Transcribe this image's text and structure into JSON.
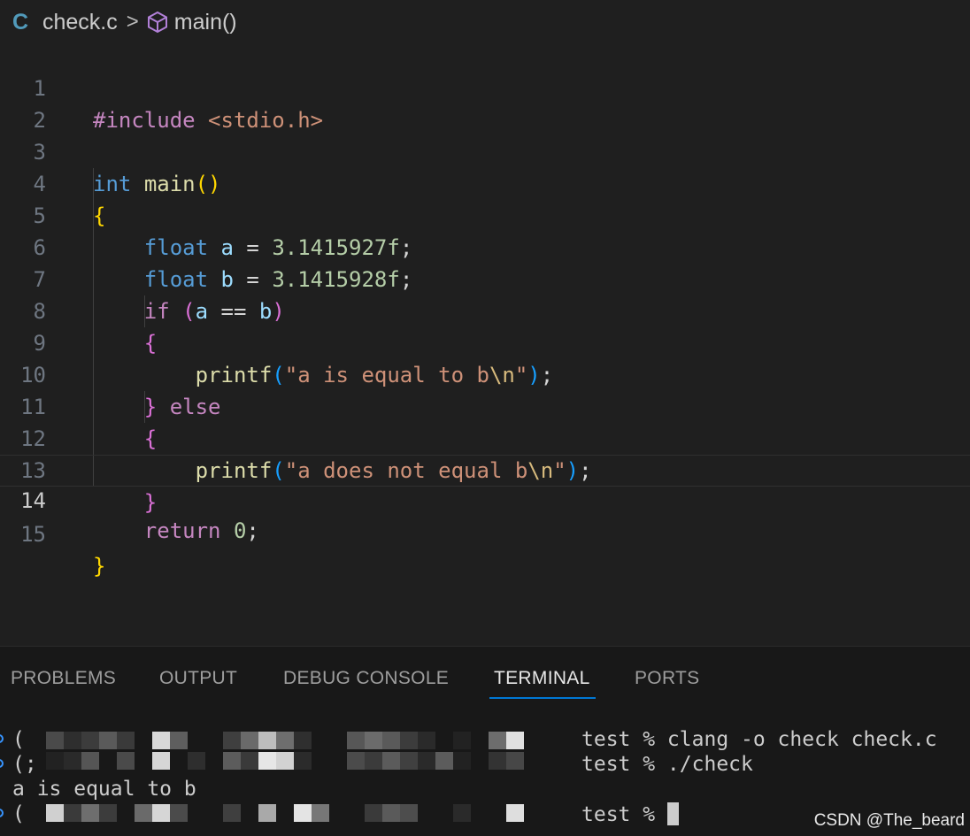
{
  "breadcrumb": {
    "file_icon": "C",
    "file": "check.c",
    "separator": ">",
    "symbol": "main()"
  },
  "code_lines": [
    {
      "num": "1"
    },
    {
      "num": "2"
    },
    {
      "num": "3"
    },
    {
      "num": "4"
    },
    {
      "num": "5"
    },
    {
      "num": "6"
    },
    {
      "num": "7"
    },
    {
      "num": "8"
    },
    {
      "num": "9"
    },
    {
      "num": "10"
    },
    {
      "num": "11"
    },
    {
      "num": "12"
    },
    {
      "num": "13"
    },
    {
      "num": "14"
    },
    {
      "num": "15"
    }
  ],
  "code": {
    "l1_directive": "#include",
    "l1_header": "<stdio.h>",
    "l3_type": "int",
    "l3_fn": "main",
    "l3_parens": "()",
    "l4_brace": "{",
    "l5_type": "float",
    "l5_var": "a",
    "l5_op": "=",
    "l5_num": "3.1415927f",
    "l5_semi": ";",
    "l6_type": "float",
    "l6_var": "b",
    "l6_op": "=",
    "l6_num": "3.1415928f",
    "l6_semi": ";",
    "l7_if": "if",
    "l7_open": "(",
    "l7_a": "a",
    "l7_op": "==",
    "l7_b": "b",
    "l7_close": ")",
    "l8_brace": "{",
    "l9_fn": "printf",
    "l9_open": "(",
    "l9_str": "\"a is equal to b",
    "l9_esc": "\\n",
    "l9_strend": "\"",
    "l9_close": ")",
    "l9_semi": ";",
    "l10_brace": "}",
    "l10_else": "else",
    "l11_brace": "{",
    "l12_fn": "printf",
    "l12_open": "(",
    "l12_str": "\"a does not equal b",
    "l12_esc": "\\n",
    "l12_strend": "\"",
    "l12_close": ")",
    "l12_semi": ";",
    "l13_brace": "}",
    "l14_return": "return",
    "l14_num": "0",
    "l14_semi": ";",
    "l15_brace": "}"
  },
  "panel": {
    "tabs": [
      "PROBLEMS",
      "OUTPUT",
      "DEBUG CONSOLE",
      "TERMINAL",
      "PORTS"
    ],
    "active_tab": "TERMINAL"
  },
  "terminal": {
    "line1_prefix": "(",
    "line1_cmd": "test % clang -o check check.c",
    "line2_prefix": "(;",
    "line2_cmd": "test % ./check",
    "line3_output": "a is equal to b",
    "line4_prefix": "(",
    "line4_cmd": "test % "
  },
  "watermark": "CSDN @The_beard",
  "colors": {
    "accent": "#0078d4",
    "editor_bg": "#1f1f1f",
    "panel_bg": "#181818"
  }
}
